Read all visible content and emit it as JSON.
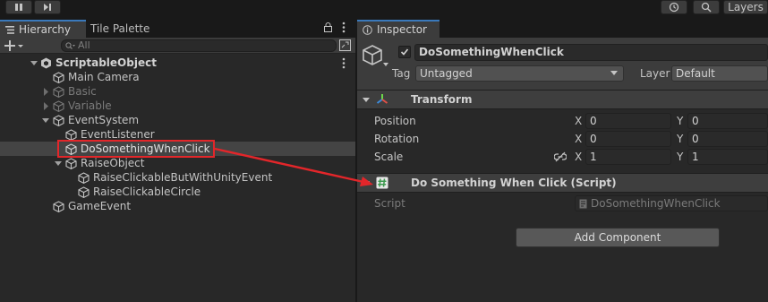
{
  "toolbar": {
    "layers_label": "Layers"
  },
  "hierarchy": {
    "tabs": [
      {
        "label": "Hierarchy",
        "active": true
      },
      {
        "label": "Tile Palette",
        "active": false
      }
    ],
    "search": {
      "placeholder": "All"
    },
    "scene": "ScriptableObject",
    "items": [
      {
        "label": "Main Camera",
        "dim": false
      },
      {
        "label": "Basic",
        "dim": true
      },
      {
        "label": "Variable",
        "dim": true
      },
      {
        "label": "EventSystem",
        "dim": false
      },
      {
        "label": "EventListener",
        "dim": false
      },
      {
        "label": "DoSomethingWhenClick",
        "dim": false,
        "selected": true
      },
      {
        "label": "RaiseObject",
        "dim": false
      },
      {
        "label": "RaiseClickableButWithUnityEvent",
        "dim": false
      },
      {
        "label": "RaiseClickableCircle",
        "dim": false
      },
      {
        "label": "GameEvent",
        "dim": false
      }
    ]
  },
  "inspector": {
    "tab_label": "Inspector",
    "object_name": "DoSomethingWhenClick",
    "object_active": true,
    "tag_label": "Tag",
    "tag_value": "Untagged",
    "layer_label": "Layer",
    "layer_value": "Default",
    "transform": {
      "title": "Transform",
      "position_label": "Position",
      "rotation_label": "Rotation",
      "scale_label": "Scale",
      "axis_x": "X",
      "axis_y": "Y",
      "position": {
        "x": "0",
        "y": "0"
      },
      "rotation": {
        "x": "0",
        "y": "0"
      },
      "scale": {
        "x": "1",
        "y": "1"
      }
    },
    "script_component": {
      "title": "Do Something When Click (Script)",
      "script_label": "Script",
      "script_value": "DoSomethingWhenClick"
    },
    "add_component_label": "Add Component"
  },
  "colors": {
    "highlight": "#e3262a",
    "tab_accent": "#3a79bb"
  }
}
